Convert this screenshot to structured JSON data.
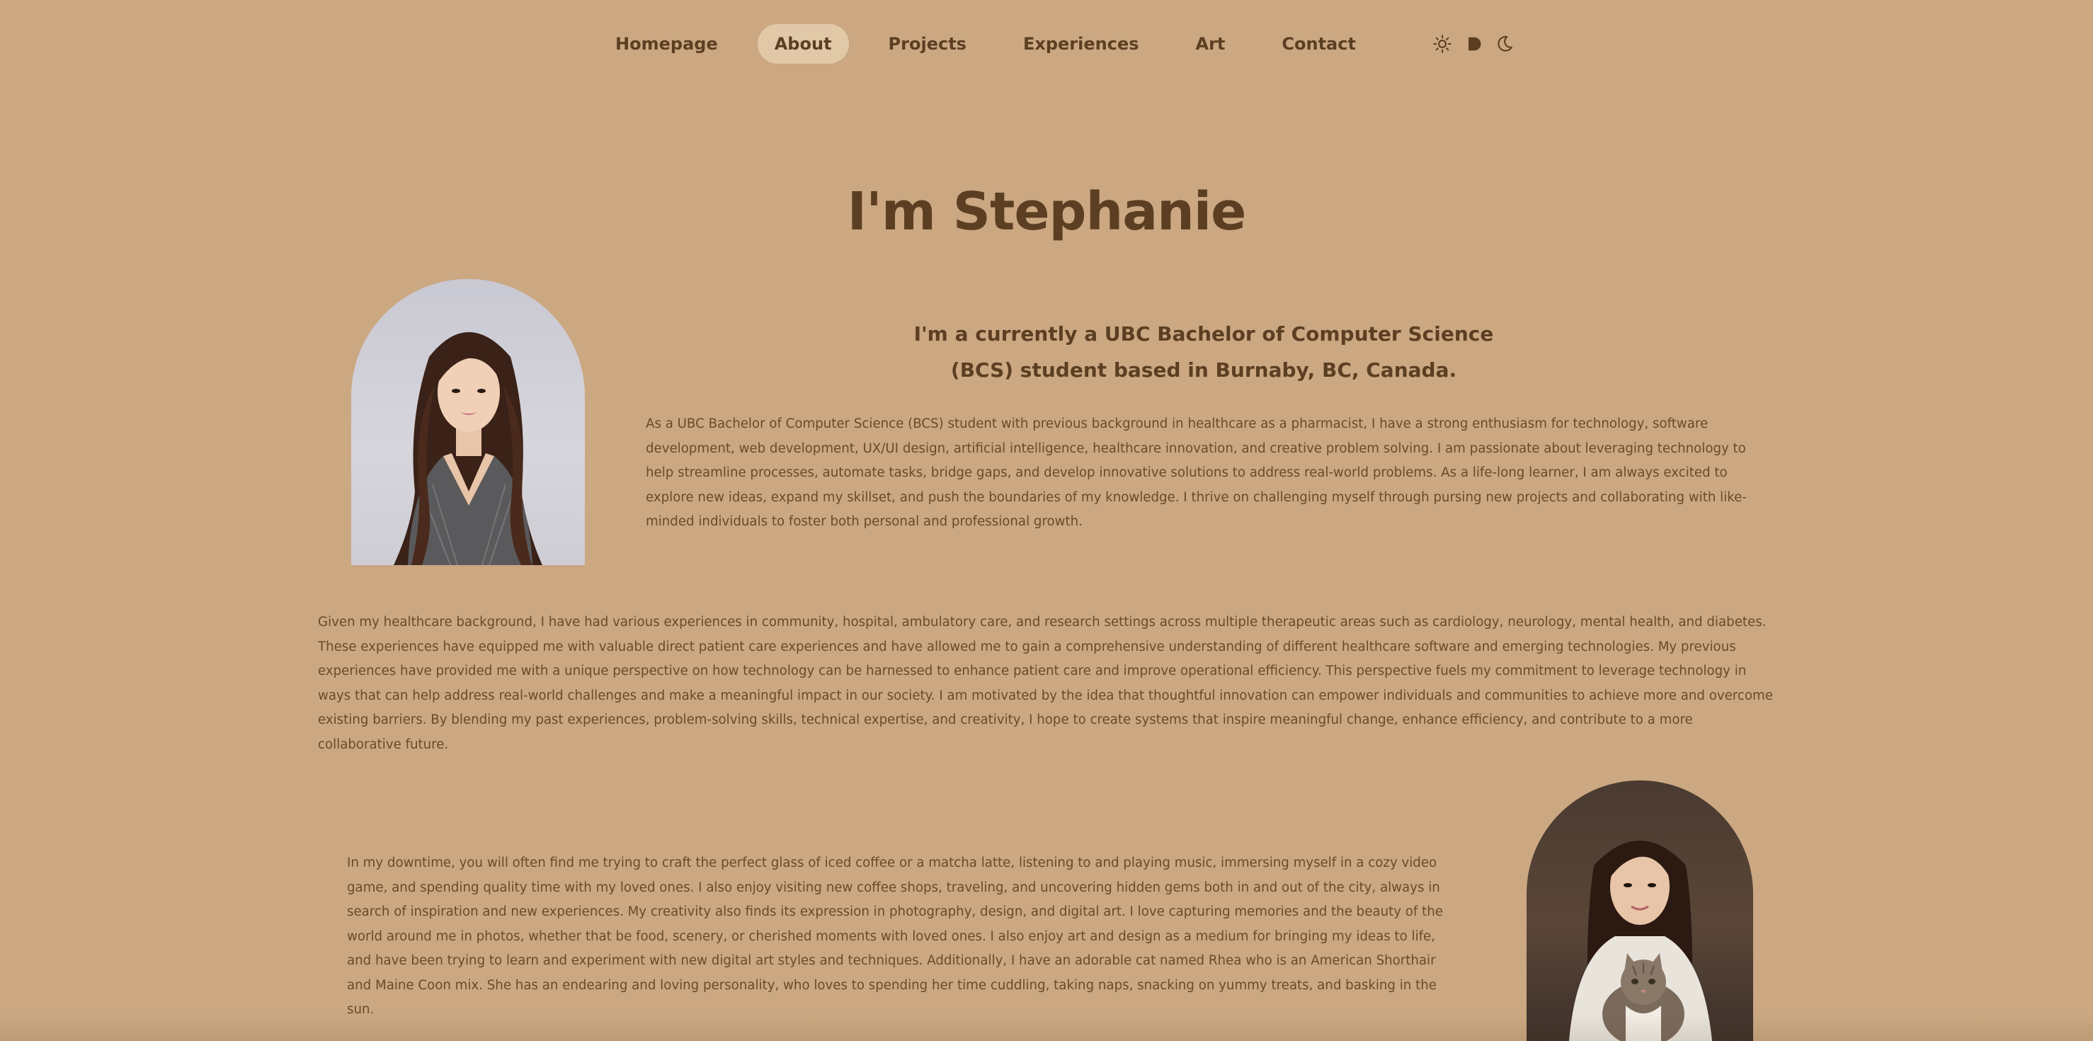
{
  "nav": {
    "items": [
      {
        "label": "Homepage",
        "active": false
      },
      {
        "label": "About",
        "active": true
      },
      {
        "label": "Projects",
        "active": false
      },
      {
        "label": "Experiences",
        "active": false
      },
      {
        "label": "Art",
        "active": false
      },
      {
        "label": "Contact",
        "active": false
      }
    ],
    "theme_icons": [
      "sun-icon",
      "theme-toggle-icon",
      "moon-icon"
    ]
  },
  "header": {
    "title": "I'm Stephanie"
  },
  "intro": {
    "subtitle_line1": "I'm a currently a UBC Bachelor of Computer Science",
    "subtitle_line2": "(BCS) student based in Burnaby, BC, Canada.",
    "paragraph1": "As a UBC Bachelor of Computer Science (BCS) student with previous background in healthcare as a pharmacist, I have a strong enthusiasm for technology, software development, web development, UX/UI design, artificial intelligence, healthcare innovation, and creative problem solving. I am passionate about leveraging technology to help streamline processes, automate tasks, bridge gaps, and develop innovative solutions to address real-world problems. As a life-long learner, I am always excited to explore new ideas, expand my skillset, and push the boundaries of my knowledge. I thrive on challenging myself through pursing new projects and collaborating with like-minded individuals to foster both personal and professional growth."
  },
  "background": {
    "paragraph": "Given my healthcare background, I have had various experiences in community, hospital, ambulatory care, and research settings across multiple therapeutic areas such as cardiology, neurology, mental health, and diabetes. These experiences have equipped me with valuable direct patient care experiences and have allowed me to gain a comprehensive understanding of different healthcare software and emerging technologies. My previous experiences have provided me with a unique perspective on how technology can be harnessed to enhance patient care and improve operational efficiency. This perspective fuels my commitment to leverage technology in ways that can help address real-world challenges and make a meaningful impact in our society. I am motivated by the idea that thoughtful innovation can empower individuals and communities to achieve more and overcome existing barriers. By blending my past experiences, problem-solving skills, technical expertise, and creativity, I hope to create systems that inspire meaningful change, enhance efficiency, and contribute to a more collaborative future."
  },
  "hobbies": {
    "paragraph": "In my downtime, you will often find me trying to craft the perfect glass of iced coffee or a matcha latte, listening to and playing music, immersing myself in a cozy video game, and spending quality time with my loved ones. I also enjoy visiting new coffee shops, traveling, and uncovering hidden gems both in and out of the city, always in search of inspiration and new experiences. My creativity also finds its expression in photography, design, and digital art. I love capturing memories and the beauty of the world around me in photos, whether that be food, scenery, or cherished moments with loved ones. I also enjoy art and design as a medium for bringing my ideas to life, and have been trying to learn and experiment with new digital art styles and techniques. Additionally, I have an adorable cat named Rhea who is an American Shorthair and Maine Coon mix. She has an endearing and loving personality, who loves to spending her time cuddling, taking naps, snacking on yummy treats, and basking in the sun."
  },
  "colors": {
    "background": "#cba882",
    "heading": "#5c3f22",
    "text": "#6a4a2a",
    "nav_active": "#e1c9a8"
  }
}
